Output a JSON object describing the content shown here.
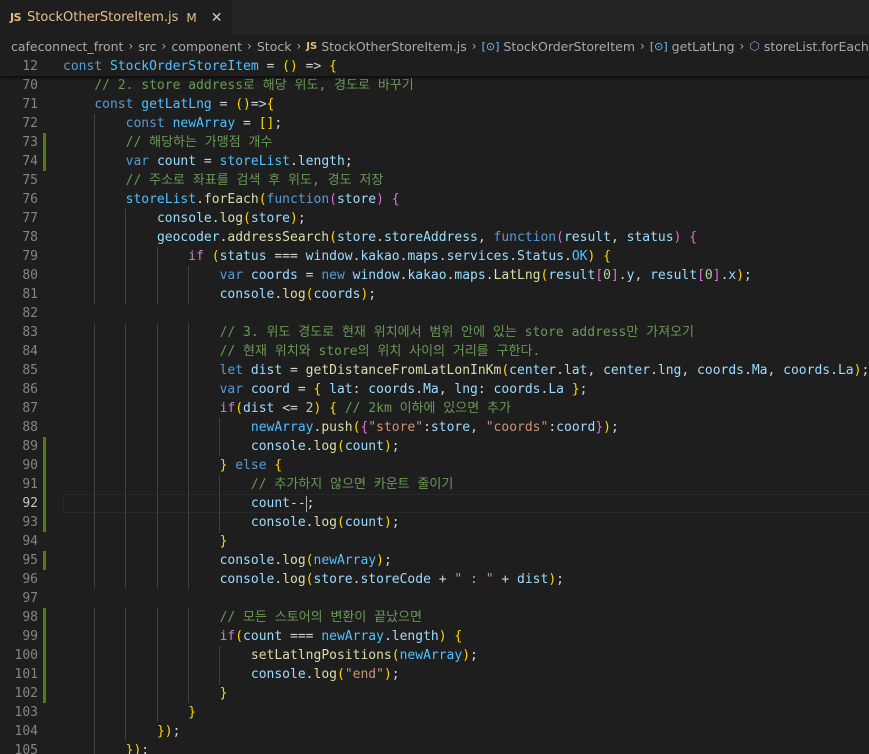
{
  "tab": {
    "badge": "JS",
    "filename": "StockOtherStoreItem.js",
    "modified": "M",
    "close": "✕"
  },
  "breadcrumb": {
    "items": [
      "cafeconnect_front",
      "src",
      "component",
      "Stock",
      "StockOtherStoreItem.js",
      "StockOrderStoreItem",
      "getLatLng",
      "storeList.forEach() callback"
    ],
    "js_badge": "JS",
    "separator": "›"
  },
  "editor": {
    "current_line": "92",
    "modified_lines": [
      "73",
      "74",
      "89",
      "90",
      "91",
      "92",
      "93",
      "95",
      "98",
      "99",
      "100",
      "101",
      "102"
    ],
    "lines": [
      {
        "n": "12",
        "t": "const StockOrderStoreItem = () => {"
      },
      {
        "n": "70",
        "t": "    // 2. store address로 해당 위도, 경도로 바꾸기"
      },
      {
        "n": "71",
        "t": "    const getLatLng = ()=>{"
      },
      {
        "n": "72",
        "t": "        const newArray = [];"
      },
      {
        "n": "73",
        "t": "        // 해당하는 가맹점 개수"
      },
      {
        "n": "74",
        "t": "        var count = storeList.length;"
      },
      {
        "n": "75",
        "t": "        // 주소로 좌표를 검색 후 위도, 경도 저장"
      },
      {
        "n": "76",
        "t": "        storeList.forEach(function(store) {"
      },
      {
        "n": "77",
        "t": "            console.log(store);"
      },
      {
        "n": "78",
        "t": "            geocoder.addressSearch(store.storeAddress, function(result, status) {"
      },
      {
        "n": "79",
        "t": "                if (status === window.kakao.maps.services.Status.OK) {"
      },
      {
        "n": "80",
        "t": "                    var coords = new window.kakao.maps.LatLng(result[0].y, result[0].x);"
      },
      {
        "n": "81",
        "t": "                    console.log(coords);"
      },
      {
        "n": "82",
        "t": ""
      },
      {
        "n": "83",
        "t": "                    // 3. 위도 경도로 현재 위치에서 범위 안에 있는 store address만 가져오기"
      },
      {
        "n": "84",
        "t": "                    // 현재 위치와 store의 위치 사이의 거리를 구한다."
      },
      {
        "n": "85",
        "t": "                    let dist = getDistanceFromLatLonInKm(center.lat, center.lng, coords.Ma, coords.La);"
      },
      {
        "n": "86",
        "t": "                    var coord = { lat: coords.Ma, lng: coords.La };"
      },
      {
        "n": "87",
        "t": "                    if(dist <= 2) { // 2km 이하에 있으면 추가"
      },
      {
        "n": "88",
        "t": "                        newArray.push({\"store\":store, \"coords\":coord});"
      },
      {
        "n": "89",
        "t": "                        console.log(count);"
      },
      {
        "n": "90",
        "t": "                    } else {"
      },
      {
        "n": "91",
        "t": "                        // 추가하지 않으면 카운트 줄이기"
      },
      {
        "n": "92",
        "t": "                        count--;"
      },
      {
        "n": "93",
        "t": "                        console.log(count);"
      },
      {
        "n": "94",
        "t": "                    }"
      },
      {
        "n": "95",
        "t": "                    console.log(newArray);"
      },
      {
        "n": "96",
        "t": "                    console.log(store.storeCode + \" : \" + dist);"
      },
      {
        "n": "97",
        "t": ""
      },
      {
        "n": "98",
        "t": "                    // 모든 스토어의 변환이 끝났으면"
      },
      {
        "n": "99",
        "t": "                    if(count === newArray.length) {"
      },
      {
        "n": "100",
        "t": "                        setLatlngPositions(newArray);"
      },
      {
        "n": "101",
        "t": "                        console.log(\"end\");"
      },
      {
        "n": "102",
        "t": "                    }"
      },
      {
        "n": "103",
        "t": "                }"
      },
      {
        "n": "104",
        "t": "            });"
      },
      {
        "n": "105",
        "t": "        });"
      }
    ]
  },
  "colors": {
    "background": "#1e1e1e",
    "keyword": "#569cd6",
    "variable": "#9cdcfe",
    "function": "#dcdcaa",
    "string": "#ce9178",
    "comment": "#6a9955",
    "modified_gutter": "#587c0c"
  },
  "icons": [
    "js-file-icon",
    "close-icon",
    "method-icon",
    "symbol-icon"
  ]
}
